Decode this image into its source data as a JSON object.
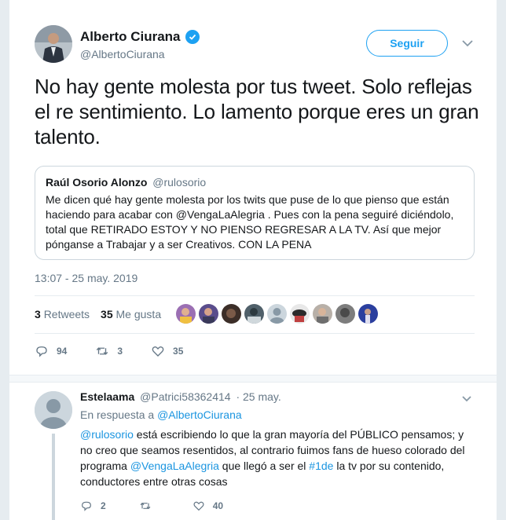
{
  "author": {
    "name": "Alberto Ciurana",
    "handle": "@AlbertoCiurana",
    "follow_label": "Seguir"
  },
  "tweet": {
    "text": "No hay gente molesta por tus tweet. Solo reflejas el re sentimiento. Lo lamento porque eres un gran talento.",
    "timestamp": "13:07 - 25 may. 2019"
  },
  "quote": {
    "name": "Raúl Osorio Alonzo",
    "handle": "@rulosorio",
    "text": "Me dicen qué hay gente molesta por los twits que puse de lo que pienso que están haciendo para acabar con @VengaLaAlegria . Pues con la pena seguiré diciéndolo, total que RETIRADO ESTOY Y NO PIENSO REGRESAR A LA TV. Así que mejor pónganse a Trabajar y a ser Creativos. CON LA PENA"
  },
  "stats": {
    "retweets_count": "3",
    "retweets_label": "Retweets",
    "likes_count": "35",
    "likes_label": "Me gusta"
  },
  "actions": {
    "replies": "94",
    "retweets": "3",
    "likes": "35"
  },
  "reply": {
    "name": "Estelaama",
    "handle": "@Patrici58362414",
    "date": "· 25 may.",
    "in_reply_prefix": "En respuesta a",
    "in_reply_handle": "@AlbertoCiurana",
    "mention": "@rulosorio",
    "text_1": " está escribiendo lo que la gran mayoría del PÚBLICO pensamos; y no creo que seamos resentidos, al contrario fuimos fans de hueso colorado del programa ",
    "link_handle": "@VengaLaAlegria",
    "text_2": " que llegó a ser el ",
    "hashtag": "#1de",
    "text_3": " la tv por su contenido, conductores entre otras cosas",
    "replies": "2",
    "retweets": "",
    "likes": "40"
  },
  "colors": {
    "accent": "#1da1f2",
    "link": "#1b95e0",
    "muted": "#657786",
    "border": "#ccd6dd"
  }
}
